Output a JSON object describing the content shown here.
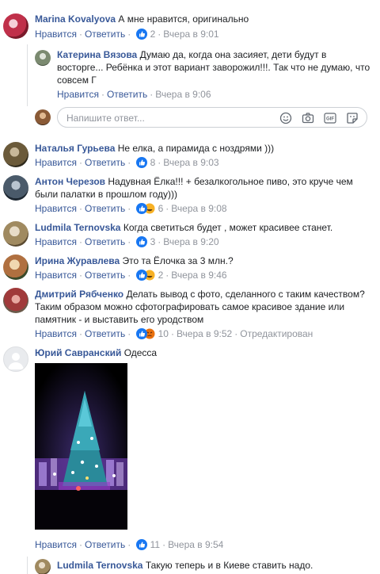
{
  "labels": {
    "like": "Нравится",
    "reply": "Ответить"
  },
  "reply_input": {
    "placeholder": "Напишите ответ..."
  },
  "comments": [
    {
      "author": "Marina Kovalyova",
      "text": "А мне нравится, оригинально",
      "reactions": "2",
      "time": "Вчера в 9:01"
    },
    {
      "author": "Катерина Вязова",
      "text": "Думаю да, когда она засияет, дети будут в восторге... Ребёнка и этот вариант заворожил!!!. Так что не думаю, что совсем Г",
      "reactions": "",
      "time": "Вчера в 9:06"
    },
    {
      "author": "Наталья Гурьева",
      "text": "Не елка, а пирамида с ноздрями )))",
      "reactions": "8",
      "time": "Вчера в 9:03"
    },
    {
      "author": "Антон Черезов",
      "text": "Надувная Ёлка!!! + безалкогольное пиво, это круче чем были палатки в прошлом году)))",
      "reactions": "6",
      "time": "Вчера в 9:08"
    },
    {
      "author": "Ludmila Ternovska",
      "text": "Когда светиться будет , может красивее станет.",
      "reactions": "3",
      "time": "Вчера в 9:20"
    },
    {
      "author": "Ирина Журавлева",
      "text": "Это та Ёлочка за 3 млн.?",
      "reactions": "2",
      "time": "Вчера в 9:46"
    },
    {
      "author": "Дмитрий Рябченко",
      "text": "Делать вывод с фото, сделанного с таким качеством? Таким образом можно сфотографировать самое красивое здание или памятник - и выставить его уродством",
      "reactions": "10",
      "time": "Вчера в 9:52",
      "edited": "Отредактирован"
    },
    {
      "author": "Юрий Савранский",
      "text": "Одесса",
      "reactions": "11",
      "time": "Вчера в 9:54"
    },
    {
      "author": "Ludmila Ternovska",
      "text": "Такую теперь и в Киеве ставить надо.",
      "reactions": "",
      "time": ""
    }
  ],
  "colors": {
    "link": "#385898",
    "meta": "#90949c",
    "like_blue": "#1877f2",
    "haha_yellow": "#f7b125",
    "angry_red": "#e9710f"
  }
}
